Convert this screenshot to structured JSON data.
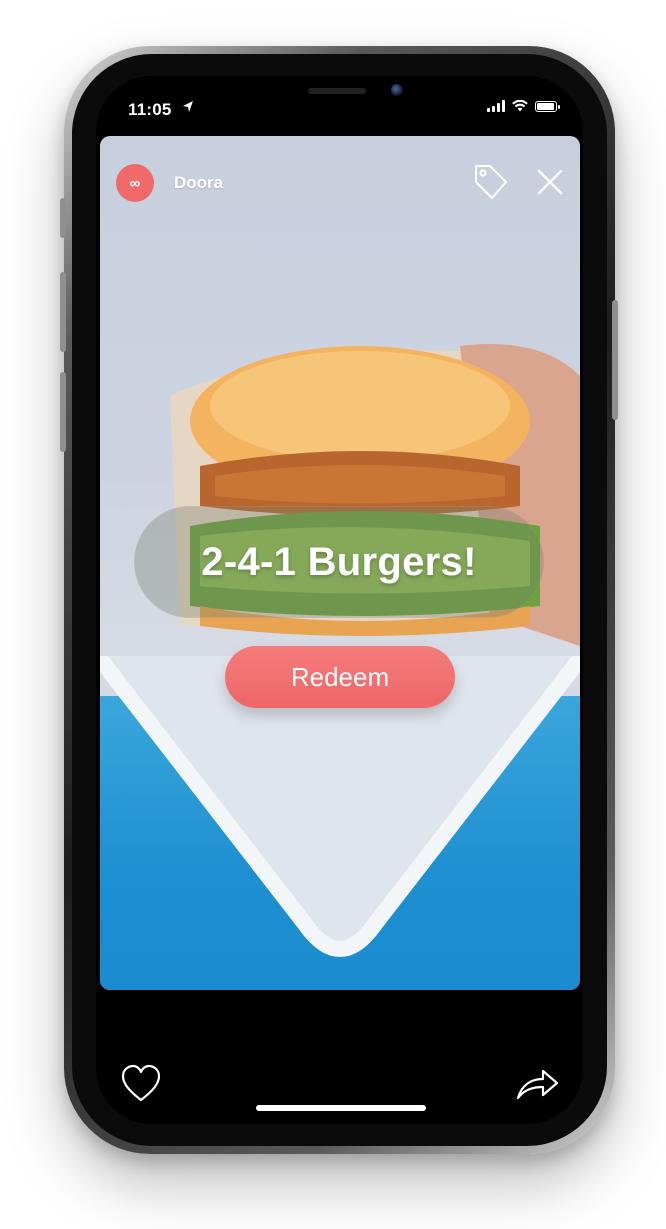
{
  "status_bar": {
    "time": "11:05",
    "battery_level": 0.95
  },
  "story": {
    "brand_name": "Doora",
    "brand_avatar_glyph": "∞",
    "promo_text": "2-4-1 Burgers!",
    "redeem_label": "Redeem"
  },
  "icons": {
    "top_right": [
      "tag-icon",
      "close-icon"
    ],
    "bottom": [
      "heart-icon",
      "share-icon"
    ]
  },
  "colors": {
    "accent": "#f06a6a",
    "button": "#ef6666",
    "sky": "#c7cfde",
    "blue": "#1e8fd0"
  }
}
